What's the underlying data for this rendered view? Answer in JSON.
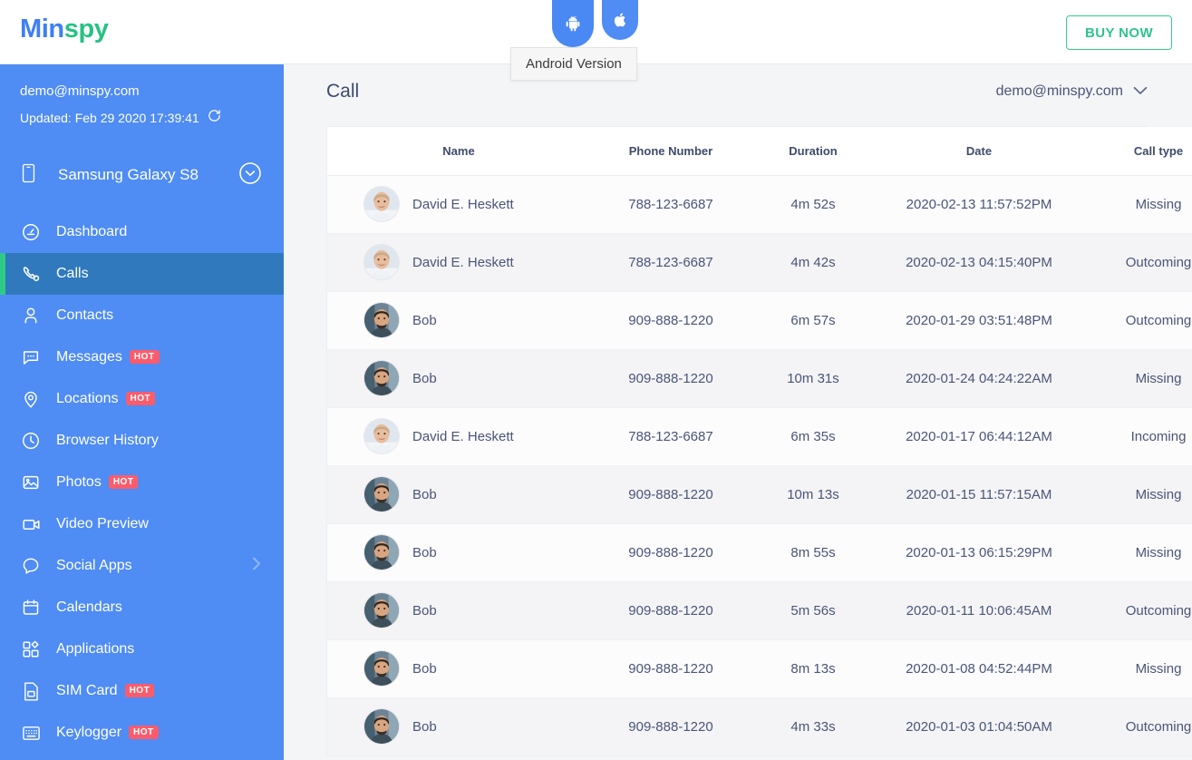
{
  "brand": {
    "part1": "Min",
    "part2": "spy",
    "blue": "#3d7ff5",
    "green": "#27c283"
  },
  "topbar": {
    "buy_now_label": "BUY NOW",
    "tooltip_text": "Android Version",
    "platform_tabs": [
      {
        "name": "android-tab",
        "icon": "android-icon",
        "active": true
      },
      {
        "name": "apple-tab",
        "icon": "apple-icon",
        "active": false
      }
    ]
  },
  "sidebar": {
    "email": "demo@minspy.com",
    "updated": "Updated: Feb 29 2020 17:39:41",
    "refresh_icon": "refresh-icon",
    "device": {
      "name": "Samsung Galaxy S8",
      "icon": "phone-icon",
      "caret": "chevron-down-circle-icon"
    },
    "items": [
      {
        "label": "Dashboard",
        "icon": "dashboard-icon",
        "hot": "",
        "active": false,
        "chevron": false
      },
      {
        "label": "Calls",
        "icon": "phone-call-icon",
        "hot": "",
        "active": true,
        "chevron": false
      },
      {
        "label": "Contacts",
        "icon": "contacts-icon",
        "hot": "",
        "active": false,
        "chevron": false
      },
      {
        "label": "Messages",
        "icon": "message-icon",
        "hot": "HOT",
        "active": false,
        "chevron": false
      },
      {
        "label": "Locations",
        "icon": "location-pin-icon",
        "hot": "HOT",
        "active": false,
        "chevron": false
      },
      {
        "label": "Browser History",
        "icon": "clock-icon",
        "hot": "",
        "active": false,
        "chevron": false
      },
      {
        "label": "Photos",
        "icon": "photo-icon",
        "hot": "HOT",
        "active": false,
        "chevron": false
      },
      {
        "label": "Video Preview",
        "icon": "video-camera-icon",
        "hot": "",
        "active": false,
        "chevron": false
      },
      {
        "label": "Social Apps",
        "icon": "chat-bubble-icon",
        "hot": "",
        "active": false,
        "chevron": true
      },
      {
        "label": "Calendars",
        "icon": "calendar-icon",
        "hot": "",
        "active": false,
        "chevron": false
      },
      {
        "label": "Applications",
        "icon": "applications-icon",
        "hot": "",
        "active": false,
        "chevron": false
      },
      {
        "label": "SIM Card",
        "icon": "sim-card-icon",
        "hot": "HOT",
        "active": false,
        "chevron": false
      },
      {
        "label": "Keylogger",
        "icon": "keyboard-icon",
        "hot": "HOT",
        "active": false,
        "chevron": false
      }
    ]
  },
  "main": {
    "page_title": "Call",
    "account_select": {
      "value": "demo@minspy.com",
      "caret": "chevron-down-icon"
    },
    "table": {
      "columns": [
        "Name",
        "Phone Number",
        "Duration",
        "Date",
        "Call type"
      ],
      "rows": [
        {
          "name": "David E. Heskett",
          "phone": "788-123-6687",
          "duration": "4m 52s",
          "date": "2020-02-13 11:57:52PM",
          "type": "Missing",
          "avatar": "david"
        },
        {
          "name": "David E. Heskett",
          "phone": "788-123-6687",
          "duration": "4m 42s",
          "date": "2020-02-13 04:15:40PM",
          "type": "Outcoming",
          "avatar": "david"
        },
        {
          "name": "Bob",
          "phone": "909-888-1220",
          "duration": "6m 57s",
          "date": "2020-01-29 03:51:48PM",
          "type": "Outcoming",
          "avatar": "bob"
        },
        {
          "name": "Bob",
          "phone": "909-888-1220",
          "duration": "10m 31s",
          "date": "2020-01-24 04:24:22AM",
          "type": "Missing",
          "avatar": "bob"
        },
        {
          "name": "David E. Heskett",
          "phone": "788-123-6687",
          "duration": "6m 35s",
          "date": "2020-01-17 06:44:12AM",
          "type": "Incoming",
          "avatar": "david"
        },
        {
          "name": "Bob",
          "phone": "909-888-1220",
          "duration": "10m 13s",
          "date": "2020-01-15 11:57:15AM",
          "type": "Missing",
          "avatar": "bob"
        },
        {
          "name": "Bob",
          "phone": "909-888-1220",
          "duration": "8m 55s",
          "date": "2020-01-13 06:15:29PM",
          "type": "Missing",
          "avatar": "bob"
        },
        {
          "name": "Bob",
          "phone": "909-888-1220",
          "duration": "5m 56s",
          "date": "2020-01-11 10:06:45AM",
          "type": "Outcoming",
          "avatar": "bob"
        },
        {
          "name": "Bob",
          "phone": "909-888-1220",
          "duration": "8m 13s",
          "date": "2020-01-08 04:52:44PM",
          "type": "Missing",
          "avatar": "bob"
        },
        {
          "name": "Bob",
          "phone": "909-888-1220",
          "duration": "4m 33s",
          "date": "2020-01-03 01:04:50AM",
          "type": "Outcoming",
          "avatar": "bob"
        }
      ]
    }
  },
  "colors": {
    "sidebar_bg": "#4f8cf4",
    "sidebar_active_bg": "#3079bd",
    "active_accent": "#2ecb86",
    "hot_badge": "#fb5c6c",
    "buy_now_border": "#35ca92",
    "page_bg": "#f4f5f7"
  }
}
